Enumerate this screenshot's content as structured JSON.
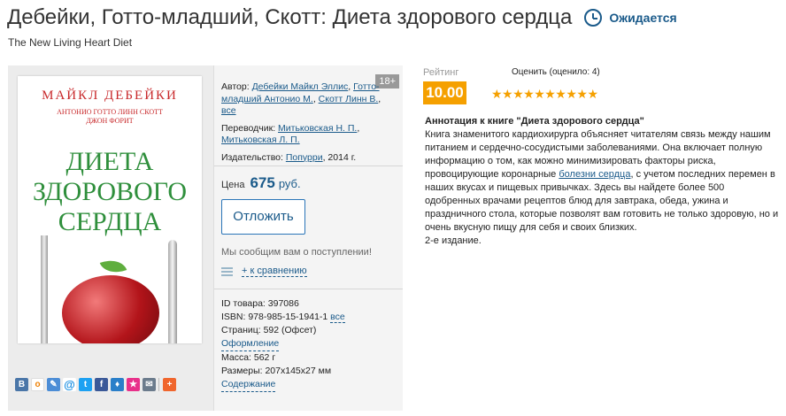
{
  "header": {
    "title": "Дебейки, Готто-младший, Скотт: Диета здорового сердца",
    "status": "Ожидается",
    "subtitle": "The New Living Heart Diet"
  },
  "cover": {
    "author": "МАЙКЛ ДЕБЕЙКИ",
    "coauthors_line1": "АНТОНИО ГОТТО ЛИНН СКОТТ",
    "coauthors_line2": "ДЖОН ФОРИТ",
    "title_line1": "ДИЕТА",
    "title_line2": "ЗДОРОВОГО",
    "title_line3": "СЕРДЦА"
  },
  "share_icons": [
    "vk-icon",
    "odnoklassniki-icon",
    "livejournal-icon",
    "mail-at-icon",
    "twitter-icon",
    "facebook-icon",
    "bookmark-icon",
    "star-icon",
    "email-icon",
    "plus-icon"
  ],
  "meta": {
    "author_label": "Автор:",
    "authors": [
      "Дебейки Майкл Эллис",
      "Готто-младший Антонио М.",
      "Скотт Линн В."
    ],
    "all_link": "все",
    "age_badge": "18+",
    "translator_label": "Переводчик:",
    "translators": [
      "Митьковская Н. П.",
      "Митьковская Л. П."
    ],
    "publisher_label": "Издательство:",
    "publisher": "Попурри",
    "year": ", 2014 г."
  },
  "price": {
    "label": "Цена",
    "value": "675",
    "currency": "руб."
  },
  "postpone_button": "Отложить",
  "notify_text": "Мы сообщим вам о поступлении!",
  "compare_link": "+ к сравнению",
  "details": {
    "id": "ID товара: 397086",
    "isbn": "ISBN: 978-985-15-1941-1",
    "isbn_all": "все",
    "pages": "Страниц: 592 (Офсет)",
    "design": "Оформление",
    "weight": "Масса: 562 г",
    "size": "Размеры: 207x145x27 мм",
    "contents": "Содержание"
  },
  "rating": {
    "label": "Рейтинг",
    "score": "10.00",
    "rate_text": "Оценить (оценило: 4)",
    "stars": 10,
    "stars_text": "★★★★★★★★★★",
    "accent": "#f5a000"
  },
  "annotation": {
    "heading": "Аннотация к книге \"Диета здорового сердца\"",
    "text1": "Книга знаменитого кардиохирурга объясняет читателям связь между нашим питанием и сердечно-сосудистыми заболеваниями. Она включает полную информацию о том, как можно минимизировать факторы риска, провоцирующие коронарные ",
    "link": "болезни сердца",
    "text2": ", с учетом последних перемен в наших вкусах и пищевых привычках. Здесь вы найдете более 500 одобренных врачами рецептов блюд для завтрака, обеда, ужина и праздничного стола, которые позволят вам готовить не только здоровую, но и очень вкусную пищу для себя и своих близких.",
    "edition": "2-е издание."
  }
}
